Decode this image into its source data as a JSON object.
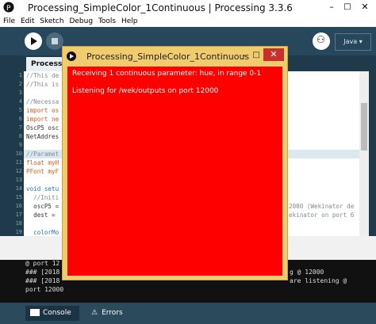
{
  "window": {
    "title": "Processing_SimpleColor_1Continuous | Processing 3.3.6"
  },
  "menu": [
    "File",
    "Edit",
    "Sketch",
    "Debug",
    "Tools",
    "Help"
  ],
  "toolbar": {
    "mode": "Java ▾"
  },
  "tab": {
    "label": "Processing_SimpleColor_1Continuous"
  },
  "editor": {
    "lines": [
      {
        "n": "1",
        "text": "//This de"
      },
      {
        "n": "2",
        "text": "//This is"
      },
      {
        "n": "3",
        "text": ""
      },
      {
        "n": "4",
        "text": "//Necessa"
      },
      {
        "n": "5",
        "text": "import os"
      },
      {
        "n": "6",
        "text": "import ne"
      },
      {
        "n": "7",
        "text": "OscP5 osc"
      },
      {
        "n": "8",
        "text": "NetAddres"
      },
      {
        "n": "9",
        "text": ""
      },
      {
        "n": "10",
        "text": "//Paramet"
      },
      {
        "n": "11",
        "text": "float myH"
      },
      {
        "n": "12",
        "text": "PFont myF"
      },
      {
        "n": "13",
        "text": ""
      },
      {
        "n": "14",
        "text": "void setu"
      },
      {
        "n": "15",
        "text": "  //Initi"
      },
      {
        "n": "16",
        "text": "  oscP5 ="
      },
      {
        "n": "17",
        "text": "  dest = "
      },
      {
        "n": "18",
        "text": ""
      },
      {
        "n": "19",
        "text": "  colorMo"
      }
    ],
    "right_fragments": [
      "2000 (Wekinator de",
      "ekinator on port 6"
    ]
  },
  "console": {
    "lines": [
      "@ port 12",
      "### [2018",
      "### [2018",
      "port 12000"
    ],
    "right_fragments": [
      "g @ 12000",
      "are listening @"
    ]
  },
  "bottom_tabs": {
    "console": "Console",
    "errors": "Errors"
  },
  "sketch_window": {
    "title": "Processing_SimpleColor_1Continuous",
    "min": "–",
    "max": "□",
    "close": "✕",
    "canvas_color": "#ff0000",
    "line1": "Receiving 1 continuous parameter: hue, in range 0-1",
    "line2": "Listening for /wek/outputs on port 12000"
  }
}
